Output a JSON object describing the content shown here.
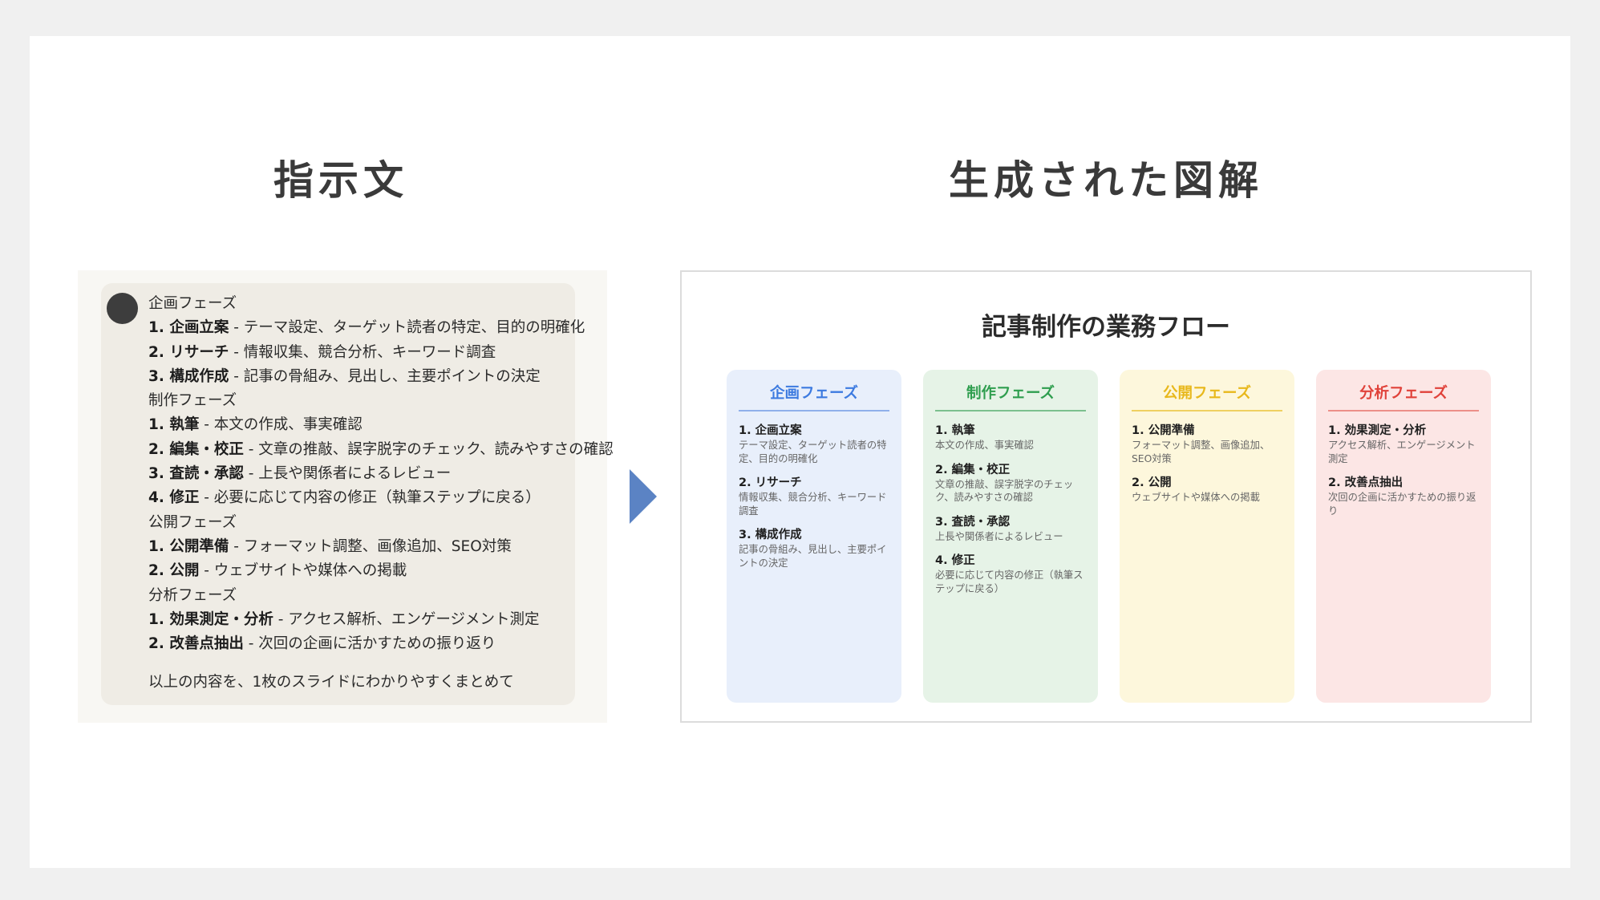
{
  "headings": {
    "left": "指示文",
    "right": "生成された図解"
  },
  "prompt": {
    "lines": [
      {
        "b": "",
        "t": "企画フェーズ"
      },
      {
        "b": "1. 企画立案",
        "t": " - テーマ設定、ターゲット読者の特定、目的の明確化"
      },
      {
        "b": "2. リサーチ",
        "t": " - 情報収集、競合分析、キーワード調査"
      },
      {
        "b": "3. 構成作成",
        "t": " - 記事の骨組み、見出し、主要ポイントの決定"
      },
      {
        "b": "",
        "t": "制作フェーズ"
      },
      {
        "b": "1. 執筆",
        "t": " - 本文の作成、事実確認"
      },
      {
        "b": "2. 編集・校正",
        "t": " - 文章の推敲、誤字脱字のチェック、読みやすさの確認"
      },
      {
        "b": "3. 査読・承認",
        "t": " - 上長や関係者によるレビュー"
      },
      {
        "b": "4. 修正",
        "t": " - 必要に応じて内容の修正（執筆ステップに戻る）"
      },
      {
        "b": "",
        "t": "公開フェーズ"
      },
      {
        "b": "1. 公開準備",
        "t": " - フォーマット調整、画像追加、SEO対策"
      },
      {
        "b": "2. 公開",
        "t": " - ウェブサイトや媒体への掲載"
      },
      {
        "b": "",
        "t": "分析フェーズ"
      },
      {
        "b": "1. 効果測定・分析",
        "t": " - アクセス解析、エンゲージメント測定"
      },
      {
        "b": "2. 改善点抽出",
        "t": " - 次回の企画に活かすための振り返り"
      }
    ],
    "footer": "以上の内容を、1枚のスライドにわかりやすくまとめて"
  },
  "diagram": {
    "title": "記事制作の業務フロー",
    "phases": [
      {
        "title": "企画フェーズ",
        "color": "#3d7be0",
        "bg": "#e8effb",
        "line": "#8fb0ea",
        "steps": [
          {
            "title": "1. 企画立案",
            "desc": "テーマ設定、ターゲット読者の特定、目的の明確化"
          },
          {
            "title": "2. リサーチ",
            "desc": "情報収集、競合分析、キーワード調査"
          },
          {
            "title": "3. 構成作成",
            "desc": "記事の骨組み、見出し、主要ポイントの決定"
          }
        ]
      },
      {
        "title": "制作フェーズ",
        "color": "#2f9e4f",
        "bg": "#e6f3e7",
        "line": "#7cc08e",
        "steps": [
          {
            "title": "1. 執筆",
            "desc": "本文の作成、事実確認"
          },
          {
            "title": "2. 編集・校正",
            "desc": "文章の推敲、誤字脱字のチェック、読みやすさの確認"
          },
          {
            "title": "3. 査読・承認",
            "desc": "上長や関係者によるレビュー"
          },
          {
            "title": "4. 修正",
            "desc": "必要に応じて内容の修正（執筆ステップに戻る）"
          }
        ]
      },
      {
        "title": "公開フェーズ",
        "color": "#e8b81c",
        "bg": "#fdf7dc",
        "line": "#efd061",
        "steps": [
          {
            "title": "1. 公開準備",
            "desc": "フォーマット調整、画像追加、SEO対策"
          },
          {
            "title": "2. 公開",
            "desc": "ウェブサイトや媒体への掲載"
          }
        ]
      },
      {
        "title": "分析フェーズ",
        "color": "#e0423a",
        "bg": "#fce6e5",
        "line": "#ec8f89",
        "steps": [
          {
            "title": "1. 効果測定・分析",
            "desc": "アクセス解析、エンゲージメント測定"
          },
          {
            "title": "2. 改善点抽出",
            "desc": "次回の企画に活かすための振り返り"
          }
        ]
      }
    ]
  }
}
